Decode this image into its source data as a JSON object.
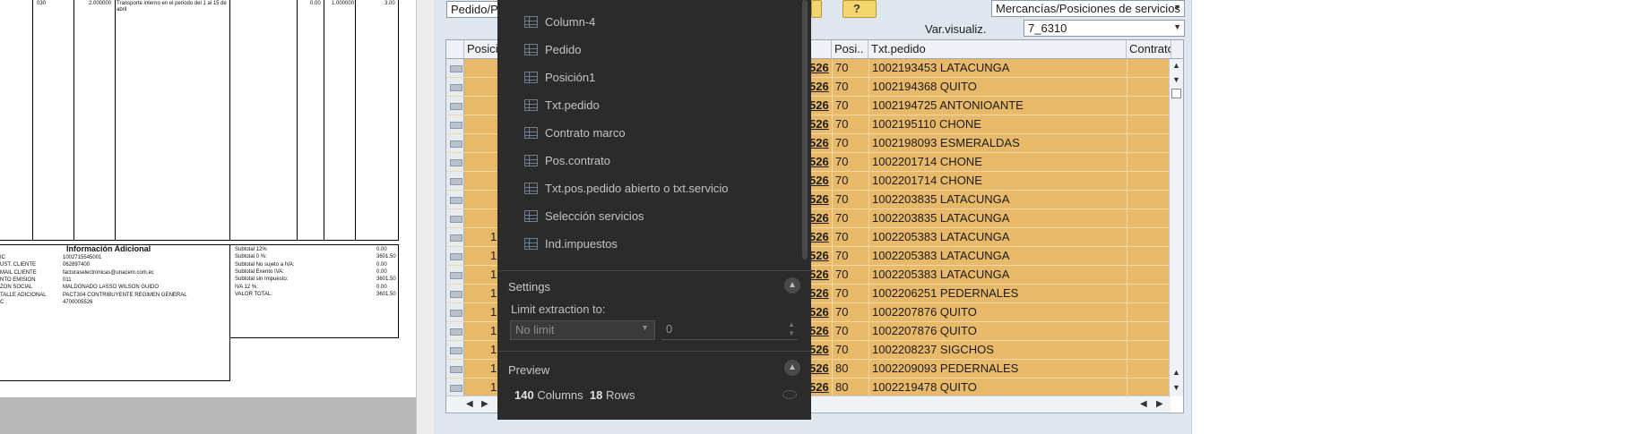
{
  "invoice": {
    "row": {
      "code": "030",
      "qty": "2.000000",
      "desc1": "Transporte interno en el periodo del 1 al 15 de",
      "desc2": "abril",
      "discount": "0.00",
      "unit": "1.000000",
      "total": "3.00"
    },
    "info_title": "Información Adicional",
    "info_labels": [
      "IC",
      "UST. CLIENTE",
      "MAIL CLIENTE",
      "NTO EMISION",
      "ZON SOCIAL",
      "TALLE ADICIONAL",
      "C"
    ],
    "info_values": [
      "1002715545001",
      "062897400",
      "facturaselectronicas@unacem.com.ec",
      "011",
      "MALDONADO LASSO WILSON GUIDO",
      "PACT304 CONTRIBUYENTE REGIMEN GENERAL",
      "4700005526"
    ],
    "totals_labels": [
      "Subtotal 12%",
      "Subtotal 0 %:",
      "Subtotal No sujeto a IVA:",
      "Subtotal Exento IVA:",
      "Subtotal sin Impuesto:",
      "IVA 12 %:",
      "VALOR TOTAL:"
    ],
    "totals_values": [
      "0.00",
      "3601.50",
      "0.00",
      "0.00",
      "3601.50",
      "0.00",
      "3601.50"
    ]
  },
  "sap": {
    "top_left_field": "Pedido/Pl",
    "top_right_dropdown": "Mercancías/Posiciones de servicios",
    "var_label": "Var.visualiz.",
    "var_value": "7_6310",
    "columns": {
      "posici": "Posici..",
      "posi": "Posi..",
      "txt_pedido": "Txt.pedido",
      "contrato": "Contrato"
    },
    "rows": [
      {
        "left": "",
        "code": "526",
        "pos": "70",
        "txt": "1002193453 LATACUNGA"
      },
      {
        "left": "",
        "code": "526",
        "pos": "70",
        "txt": "1002194368 QUITO"
      },
      {
        "left": "",
        "code": "526",
        "pos": "70",
        "txt": "1002194725 ANTONIOANTE"
      },
      {
        "left": "",
        "code": "526",
        "pos": "70",
        "txt": "1002195110 CHONE"
      },
      {
        "left": "",
        "code": "526",
        "pos": "70",
        "txt": "1002198093 ESMERALDAS"
      },
      {
        "left": "",
        "code": "526",
        "pos": "70",
        "txt": "1002201714 CHONE"
      },
      {
        "left": "",
        "code": "526",
        "pos": "70",
        "txt": "1002201714 CHONE"
      },
      {
        "left": "",
        "code": "526",
        "pos": "70",
        "txt": "1002203835 LATACUNGA"
      },
      {
        "left": "",
        "code": "526",
        "pos": "70",
        "txt": "1002203835 LATACUNGA"
      },
      {
        "left": "1",
        "code": "526",
        "pos": "70",
        "txt": "1002205383 LATACUNGA"
      },
      {
        "left": "1",
        "code": "526",
        "pos": "70",
        "txt": "1002205383 LATACUNGA"
      },
      {
        "left": "1",
        "code": "526",
        "pos": "70",
        "txt": "1002205383 LATACUNGA"
      },
      {
        "left": "1",
        "code": "526",
        "pos": "70",
        "txt": "1002206251 PEDERNALES"
      },
      {
        "left": "1",
        "code": "526",
        "pos": "70",
        "txt": "1002207876 QUITO"
      },
      {
        "left": "1",
        "code": "526",
        "pos": "70",
        "txt": "1002207876 QUITO"
      },
      {
        "left": "1",
        "code": "526",
        "pos": "70",
        "txt": "1002208237 SIGCHOS"
      },
      {
        "left": "1",
        "code": "526",
        "pos": "80",
        "txt": "1002209093 PEDERNALES"
      },
      {
        "left": "1",
        "code": "526",
        "pos": "80",
        "txt": "1002219478 QUITO"
      }
    ]
  },
  "panel": {
    "column_items": [
      "Column-4",
      "Pedido",
      "Posición1",
      "Txt.pedido",
      "Contrato marco",
      "Pos.contrato",
      "Txt.pos.pedido abierto o txt.servicio",
      "Selección servicios",
      "Ind.impuestos"
    ],
    "settings_title": "Settings",
    "limit_label": "Limit extraction to:",
    "limit_select": "No limit",
    "limit_number": "0",
    "preview_title": "Preview",
    "columns_count": "140",
    "columns_word": "Columns",
    "rows_count": "18",
    "rows_word": "Rows"
  },
  "colors": {
    "row_highlight": "#e9b96a",
    "panel_bg": "#2b2b2b",
    "sap_bg": "#dfe6ee"
  }
}
